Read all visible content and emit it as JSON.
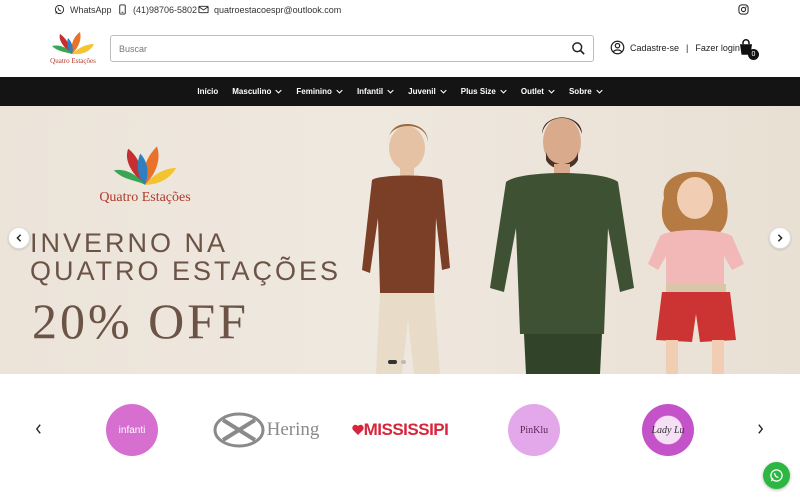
{
  "topbar": {
    "whatsapp_label": "WhatsApp",
    "phone": "(41)98706-5802",
    "email": "quatroestacoespr@outlook.com"
  },
  "header": {
    "logo_text": "Quatro Estações",
    "search_placeholder": "Buscar",
    "signup_label": "Cadastre-se",
    "separator": "|",
    "login_label": "Fazer login",
    "cart_count": "0"
  },
  "nav": {
    "items": [
      {
        "label": "Início",
        "has_dropdown": false
      },
      {
        "label": "Masculino",
        "has_dropdown": true
      },
      {
        "label": "Feminino",
        "has_dropdown": true
      },
      {
        "label": "Infantil",
        "has_dropdown": true
      },
      {
        "label": "Juvenil",
        "has_dropdown": true
      },
      {
        "label": "Plus Size",
        "has_dropdown": true
      },
      {
        "label": "Outlet",
        "has_dropdown": true
      },
      {
        "label": "Sobre",
        "has_dropdown": true
      }
    ]
  },
  "hero": {
    "brand": "Quatro Estações",
    "line1": "INVERNO NA",
    "line2": "QUATRO ESTAÇÕES",
    "offer": "20% OFF",
    "slide_count": 2,
    "active_slide": 1
  },
  "brands": {
    "items": [
      {
        "name": "infanti",
        "color": "#d66fcf"
      },
      {
        "name": "Hering",
        "color": "#8a8a8a"
      },
      {
        "name": "MISSISSIPI",
        "color": "#d8253c"
      },
      {
        "name": "PinKlu",
        "color": "#e3a8ea"
      },
      {
        "name": "Lady Lu",
        "color": "#c453c9"
      }
    ]
  },
  "colors": {
    "nav_bg": "#141414",
    "hero_text": "#6b5346",
    "brand_red": "#b03a2a",
    "whatsapp_green": "#2db742"
  }
}
